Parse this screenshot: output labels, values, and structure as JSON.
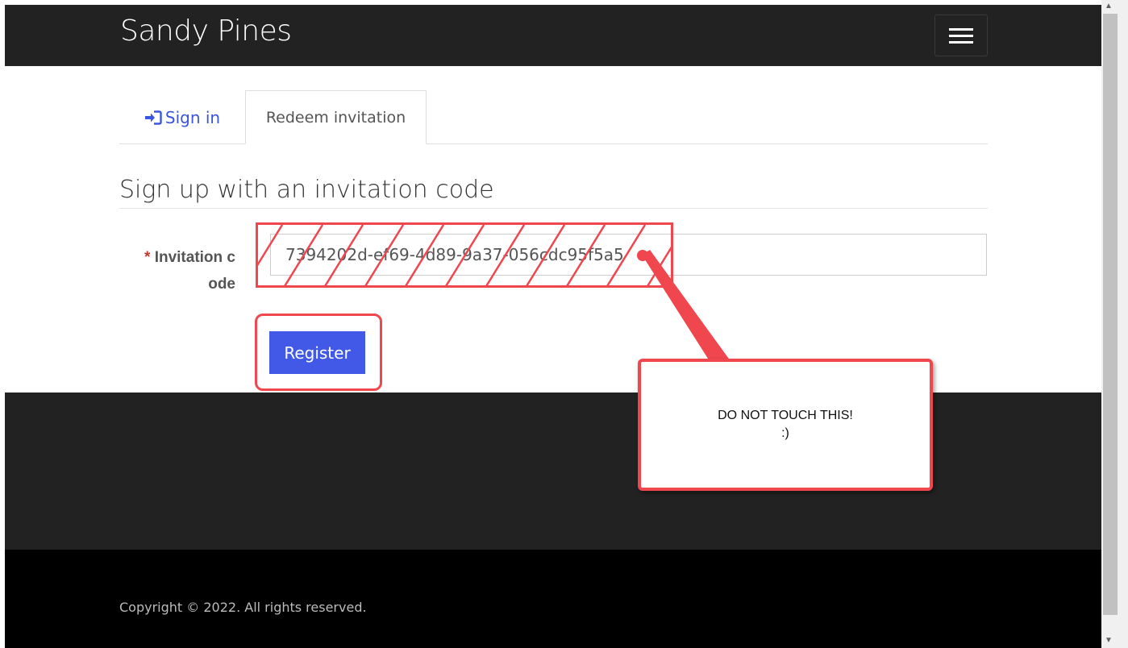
{
  "navbar": {
    "brand": "Sandy Pines",
    "menu_icon": "hamburger-menu-icon"
  },
  "tabs": [
    {
      "label": "Sign in",
      "icon": "sign-in-icon",
      "active": false
    },
    {
      "label": "Redeem invitation",
      "active": true
    }
  ],
  "form": {
    "title": "Sign up with an invitation code",
    "required_mark": "*",
    "field_label_line1": "Invitation c",
    "field_label_line2": "ode",
    "invitation_code": "7394202d-ef69-4d89-9a37-056cdc95f5a5",
    "submit_label": "Register"
  },
  "annotation": {
    "line1": "DO NOT TOUCH THIS!",
    "line2": ":)",
    "color": "#f0474f"
  },
  "footer": {
    "copyright": "Copyright © 2022. All rights reserved."
  },
  "colors": {
    "accent": "#4159e6",
    "navbar_bg": "#222222",
    "footer_bottom_bg": "#000000"
  }
}
